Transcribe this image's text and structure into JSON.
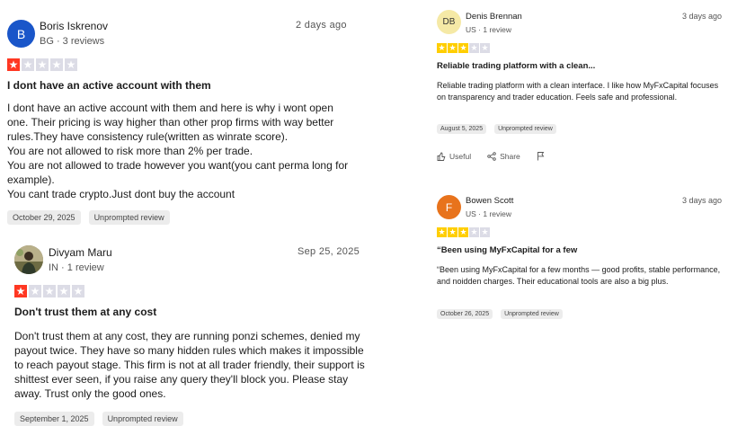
{
  "colors": {
    "star_red": "#ff3722",
    "star_yellow": "#ffce00",
    "star_empty": "#dcdce6",
    "tag_bg": "#ececec"
  },
  "reviews": [
    {
      "initial": "B",
      "avatar_color": "#1a56c9",
      "name": "Boris Iskrenov",
      "meta": "BG · 3 reviews",
      "date": "2 days ago",
      "rating": 1,
      "title": "I dont have an active account with them",
      "body": [
        "I dont have an active account with them and here is why i wont open one. Their pricing is way higher than other prop firms with way better rules.They have consistency rule(written as winrate score).",
        "You are not allowed to risk more than 2% per trade.",
        "You are not allowed to trade however you want(you cant perma long for example).",
        "You cant trade crypto.Just dont buy the account"
      ],
      "experience_date": "October 29, 2025",
      "tag": "Unprompted review"
    },
    {
      "avatar_icon": "profile-photo",
      "name": "Divyam Maru",
      "meta": "IN · 1 review",
      "date": "Sep 25, 2025",
      "rating": 1,
      "title": "Don't trust them at any cost",
      "body": [
        "Don't trust them at any cost, they are running ponzi schemes, denied my payout twice. They have so many hidden rules which makes it impossible to reach payout stage. This firm is not at all trader friendly, their support is shittest ever seen, if you raise any query they'll block you. Please stay away. Trust only the good ones."
      ],
      "experience_date": "September 1, 2025",
      "tag": "Unprompted review"
    },
    {
      "initial": "DB",
      "avatar_color": "#f5e9a6",
      "avatar_text_color": "#333333",
      "name": "Denis Brennan",
      "meta": "US · 1 review",
      "date": "3 days ago",
      "rating": 3,
      "title": "Reliable trading platform with a clean...",
      "body": [
        "Reliable trading platform with a clean interface. I like how MyFxCapital focuses on transparency and trader education. Feels safe and professional."
      ],
      "experience_date": "August 5, 2025",
      "tag": "Unprompted review",
      "actions": {
        "useful": "Useful",
        "share": "Share"
      }
    },
    {
      "initial": "F",
      "avatar_color": "#e8731c",
      "name": "Bowen Scott",
      "meta": "US · 1 review",
      "date": "3 days ago",
      "rating": 3,
      "title": "“Been using MyFxCapital for a few",
      "body": [
        "“Been using MyFxCapital for a few months — good profits, stable performance, and noidden charges. Their educational tools are also a big plus."
      ],
      "experience_date": "October 26, 2025",
      "tag": "Unprompted review"
    }
  ]
}
